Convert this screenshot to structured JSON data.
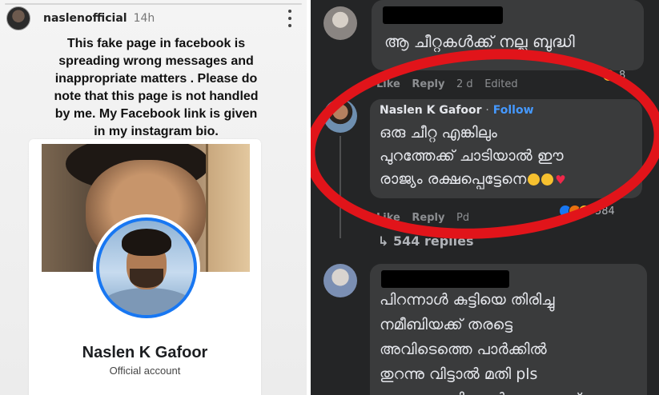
{
  "story": {
    "username": "naslenofficial",
    "time": "14h",
    "progress": 0,
    "caption_lines": [
      "This fake page in facebook is",
      "spreading wrong messages and",
      "inappropriate matters . Please do",
      "note that this page is not handled",
      "by me.  My Facebook  link is given",
      "in my instagram bio."
    ],
    "card": {
      "name": "Naslen K Gafoor",
      "subtitle": "Official account"
    }
  },
  "comments": {
    "top": {
      "text": "ആ ചീറ്റകൾക്ക് നല്ല ബുദ്ധി",
      "actions": [
        "Like",
        "Reply",
        "2 d",
        "Edited"
      ],
      "react_count": "8"
    },
    "highlighted": {
      "author": "Naslen K Gafoor",
      "separator": "·",
      "follow": "Follow",
      "lines": [
        "ഒരു ചീറ്റ എങ്കിലും",
        "പുറത്തേക്ക് ചാടിയാൽ ഈ",
        "രാജ്യം രക്ഷപ്പെട്ടേനെ"
      ],
      "actions": [
        "Like",
        "Reply",
        "Pd"
      ],
      "react_count": "584",
      "replies_label": "↳ 544 replies"
    },
    "bottom": {
      "lines": [
        "പിറന്നാൾ കുട്ടിയെ തിരിച്ചു",
        "നമീബിയക്ക് തരട്ടെ",
        "അവിടെത്തെ പാർക്കിൽ",
        "തുറന്നു വിട്ടാൽ മതി pls",
        "ശല്യം സഹിക്കാൻ വയ്യ അത്"
      ]
    }
  },
  "colors": {
    "facebook_blue": "#1877f2",
    "highlight_red": "#e1141a",
    "dark_bg": "#242526"
  },
  "icons": {
    "story_menu": "more-vertical-icon",
    "reply_arrow": "reply-arrow-icon"
  }
}
